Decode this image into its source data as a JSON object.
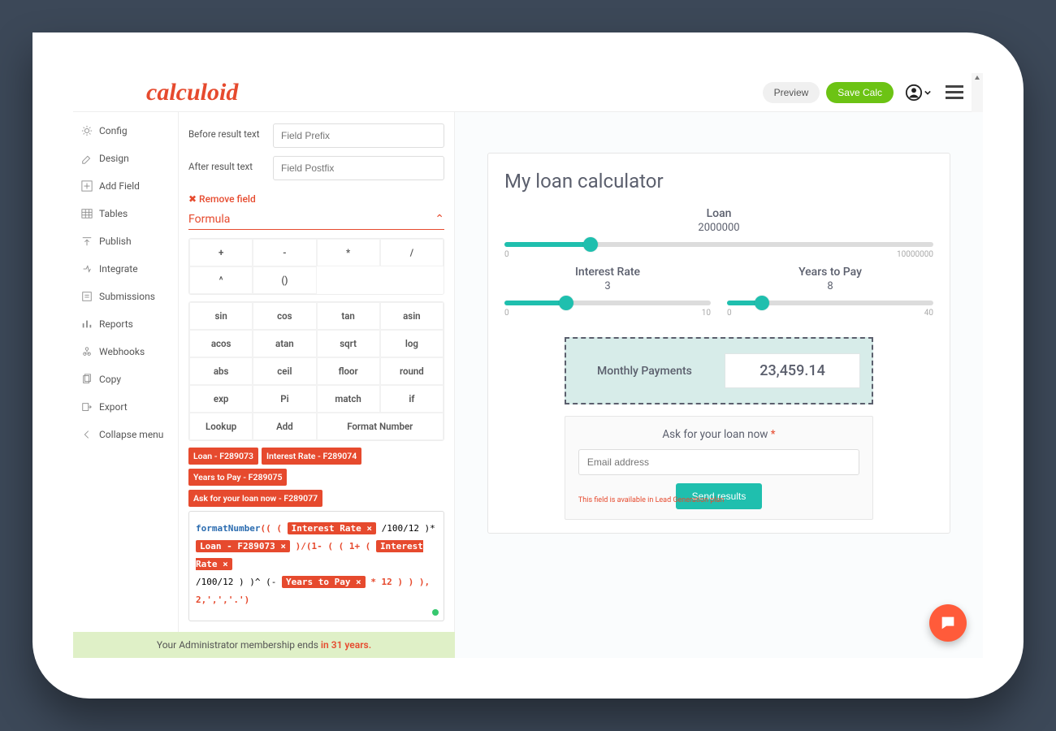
{
  "brand": "calculoid",
  "topbar": {
    "preview": "Preview",
    "save": "Save Calc"
  },
  "sidebar": {
    "items": [
      {
        "label": "Config"
      },
      {
        "label": "Design"
      },
      {
        "label": "Add Field"
      },
      {
        "label": "Tables"
      },
      {
        "label": "Publish"
      },
      {
        "label": "Integrate"
      },
      {
        "label": "Submissions"
      },
      {
        "label": "Reports"
      },
      {
        "label": "Webhooks"
      },
      {
        "label": "Copy"
      },
      {
        "label": "Export"
      },
      {
        "label": "Collapse menu"
      }
    ]
  },
  "editor": {
    "before_label": "Before result text",
    "before_placeholder": "Field Prefix",
    "after_label": "After result text",
    "after_placeholder": "Field Postfix",
    "remove": "Remove field",
    "section": "Formula",
    "ops_basic": [
      "+",
      "-",
      "*",
      "/",
      "^",
      "()"
    ],
    "ops_fn": [
      "sin",
      "cos",
      "tan",
      "asin",
      "acos",
      "atan",
      "sqrt",
      "log",
      "abs",
      "ceil",
      "floor",
      "round",
      "exp",
      "Pi",
      "match",
      "if",
      "Lookup",
      "Add",
      "Format Number"
    ],
    "tags": [
      "Loan - F289073",
      "Interest Rate - F289074",
      "Years to Pay - F289075",
      "Ask for your loan now - F289077"
    ],
    "formula": {
      "fn": "formatNumber",
      "chip_ir": "Interest Rate ×",
      "seg1": "/100/12 )*",
      "chip_loan": "Loan - F289073 ×",
      "seg2": ")/(1- ( ( 1+ (",
      "chip_ir2": "Interest Rate ×",
      "seg3": "/100/12 ) )^ (-",
      "chip_ytp": "Years to Pay ×",
      "seg4": "* 12 )  )  ), 2,',','.')"
    }
  },
  "preview": {
    "title": "My loan calculator",
    "loan": {
      "label": "Loan",
      "value": "2000000",
      "min": "0",
      "max": "10000000",
      "pct": 20
    },
    "rate": {
      "label": "Interest Rate",
      "value": "3",
      "min": "0",
      "max": "10",
      "pct": 30
    },
    "years": {
      "label": "Years to Pay",
      "value": "8",
      "min": "0",
      "max": "40",
      "pct": 17
    },
    "result_label": "Monthly Payments",
    "result_value": "23,459.14",
    "cta_title": "Ask for your loan now",
    "cta_required": "*",
    "cta_placeholder": "Email address",
    "cta_note": "This field is available in Lead Generation plan",
    "cta_button": "Send results"
  },
  "membership": {
    "prefix": "Your Administrator membership ends ",
    "emph": "in 31 years."
  }
}
